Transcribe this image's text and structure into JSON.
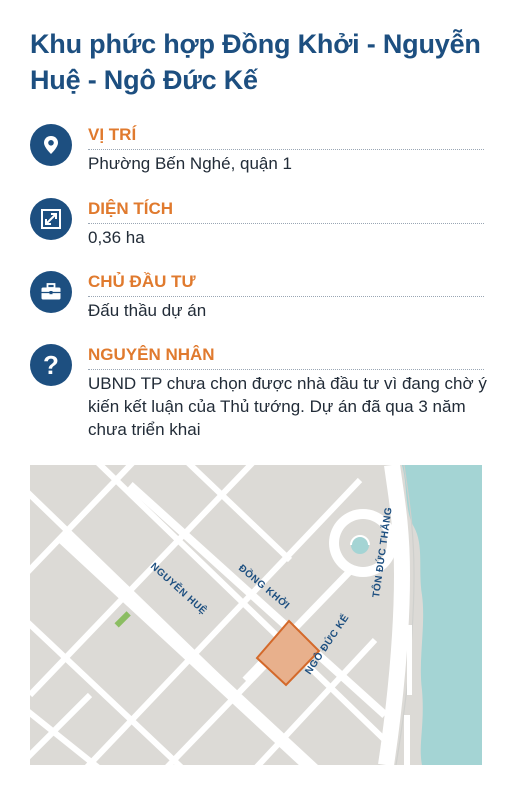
{
  "title": "Khu phức hợp Đồng Khởi - Nguyễn Huệ - Ngô Đức Kế",
  "rows": [
    {
      "icon": "location-pin-icon",
      "label": "VỊ TRÍ",
      "value": "Phường Bến Nghé, quận 1"
    },
    {
      "icon": "expand-arrows-icon",
      "label": "DIỆN TÍCH",
      "value": "0,36 ha"
    },
    {
      "icon": "briefcase-icon",
      "label": "CHỦ ĐẦU TƯ",
      "value": "Đấu thầu dự án"
    },
    {
      "icon": "question-mark-icon",
      "label": "NGUYÊN NHÂN",
      "value": "UBND TP chưa chọn được nhà đầu tư vì đang chờ ý kiến kết luận của Thủ tướng. Dự án đã qua 3 năm chưa triển khai"
    }
  ],
  "map": {
    "streets": {
      "nguyen_hue": "NGUYỄN HUỆ",
      "dong_khoi": "ĐỒNG KHỞI",
      "ngo_duc_ke": "NGÔ ĐỨC KẾ",
      "ton_duc_thang": "TÔN ĐỨC THẮNG"
    }
  },
  "colors": {
    "title": "#1d4f80",
    "label": "#e07a2e",
    "icon_bg": "#1d4f80",
    "map_land": "#dcdad6",
    "map_water": "#a4d4d4",
    "project_fill": "#e8b08c",
    "project_stroke": "#d4692a"
  }
}
